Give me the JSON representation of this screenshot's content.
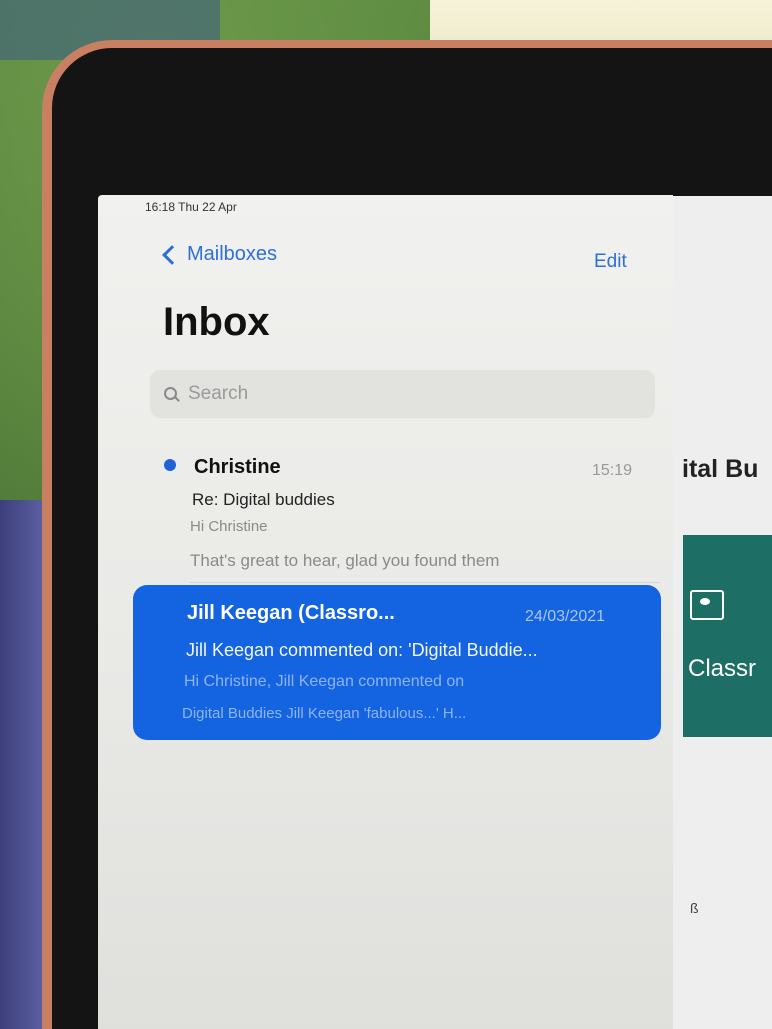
{
  "status_bar": {
    "time_date": "16:18 Thu 22 Apr"
  },
  "nav": {
    "back_label": "Mailboxes",
    "edit_label": "Edit"
  },
  "title": "Inbox",
  "search": {
    "placeholder": "Search"
  },
  "messages": [
    {
      "sender": "Christine",
      "time": "15:19",
      "subject": "Re: Digital buddies",
      "preview_line1": "Hi Christine",
      "preview_line2": "That's great to hear, glad you found them",
      "unread": true
    },
    {
      "sender": "Jill Keegan (Classro...",
      "time": "24/03/2021",
      "subject": "Jill Keegan commented on: 'Digital Buddie...",
      "preview_line1": "Hi Christine, Jill Keegan commented on",
      "preview_line2": "Digital Buddies Jill Keegan 'fabulous...' H...",
      "selected": true
    }
  ],
  "detail": {
    "title_fragment": "ital Bu",
    "card_text": "Classr",
    "mark": "ß"
  },
  "colors": {
    "accent": "#2f6fd6",
    "selected_row": "#1463e0",
    "card": "#1d6e64"
  }
}
